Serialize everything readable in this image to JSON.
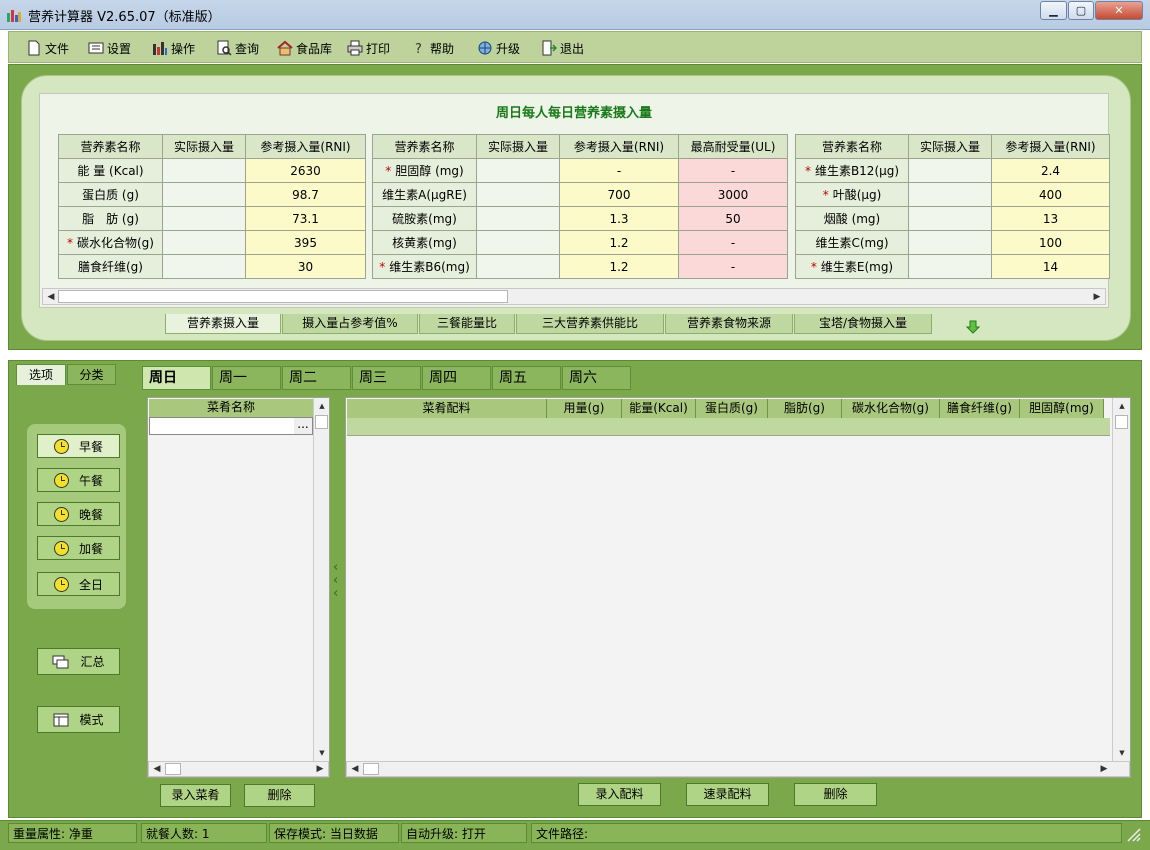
{
  "window": {
    "title": "营养计算器 V2.65.07（标准版）",
    "min": "▁",
    "max": "▢",
    "close": "✕"
  },
  "menu": [
    {
      "label": "文件",
      "icon": "file-icon"
    },
    {
      "label": "设置",
      "icon": "settings-icon"
    },
    {
      "label": "操作",
      "icon": "bar-chart-icon"
    },
    {
      "label": "查询",
      "icon": "search-doc-icon"
    },
    {
      "label": "食品库",
      "icon": "house-icon"
    },
    {
      "label": "打印",
      "icon": "printer-icon"
    },
    {
      "label": "帮助",
      "icon": "help-icon"
    },
    {
      "label": "升级",
      "icon": "globe-icon"
    },
    {
      "label": "退出",
      "icon": "exit-icon"
    }
  ],
  "nutrient_panel": {
    "title": "周日每人每日营养素摄入量",
    "table1": {
      "headers": [
        "营养素名称",
        "实际摄入量",
        "参考摄入量(RNI)"
      ],
      "rows": [
        {
          "star": false,
          "name": "能 量 (Kcal)",
          "actual": "",
          "rni": "2630"
        },
        {
          "star": false,
          "name": "蛋白质 (g)",
          "actual": "",
          "rni": "98.7"
        },
        {
          "star": false,
          "name": "脂　肪 (g)",
          "actual": "",
          "rni": "73.1"
        },
        {
          "star": true,
          "name": "碳水化合物(g)",
          "actual": "",
          "rni": "395"
        },
        {
          "star": false,
          "name": "膳食纤维(g)",
          "actual": "",
          "rni": "30"
        }
      ]
    },
    "table2": {
      "headers": [
        "营养素名称",
        "实际摄入量",
        "参考摄入量(RNI)",
        "最高耐受量(UL)"
      ],
      "rows": [
        {
          "star": true,
          "name": "胆固醇 (mg)",
          "actual": "",
          "rni": "-",
          "ul": "-"
        },
        {
          "star": false,
          "name": "维生素A(μgRE)",
          "actual": "",
          "rni": "700",
          "ul": "3000"
        },
        {
          "star": false,
          "name": "硫胺素(mg)",
          "actual": "",
          "rni": "1.3",
          "ul": "50"
        },
        {
          "star": false,
          "name": "核黄素(mg)",
          "actual": "",
          "rni": "1.2",
          "ul": "-"
        },
        {
          "star": true,
          "name": "维生素B6(mg)",
          "actual": "",
          "rni": "1.2",
          "ul": "-"
        }
      ]
    },
    "table3": {
      "headers": [
        "营养素名称",
        "实际摄入量",
        "参考摄入量(RNI)"
      ],
      "rows": [
        {
          "star": true,
          "name": "维生素B12(μg)",
          "actual": "",
          "rni": "2.4"
        },
        {
          "star": true,
          "name": "叶酸(μg)",
          "actual": "",
          "rni": "400"
        },
        {
          "star": false,
          "name": "烟酸 (mg)",
          "actual": "",
          "rni": "13"
        },
        {
          "star": false,
          "name": "维生素C(mg)",
          "actual": "",
          "rni": "100"
        },
        {
          "star": true,
          "name": "维生素E(mg)",
          "actual": "",
          "rni": "14"
        }
      ]
    }
  },
  "bottom_tabs": [
    "营养素摄入量",
    "摄入量占参考值%",
    "三餐能量比",
    "三大营养素供能比",
    "营养素食物来源",
    "宝塔/食物摄入量"
  ],
  "left_tabs": [
    "选项",
    "分类"
  ],
  "meal_buttons": [
    "早餐",
    "午餐",
    "晚餐",
    "加餐",
    "全日"
  ],
  "extra_buttons": [
    "汇总",
    "模式"
  ],
  "day_tabs": [
    "周日",
    "周一",
    "周二",
    "周三",
    "周四",
    "周五",
    "周六"
  ],
  "dish_header": "菜肴名称",
  "dish_input": "",
  "grid_headers": [
    "菜肴配料",
    "用量(g)",
    "能量(Kcal)",
    "蛋白质(g)",
    "脂肪(g)",
    "碳水化合物(g)",
    "膳食纤维(g)",
    "胆固醇(mg)"
  ],
  "buttons": {
    "add_dish": "录入菜肴",
    "delete_dish": "删除",
    "add_ingredient": "录入配料",
    "quick_ingredient": "速录配料",
    "delete_ingredient": "删除"
  },
  "status": {
    "weight": "重量属性: 净重",
    "diners": "就餐人数: 1",
    "save_mode": "保存模式: 当日数据",
    "auto_update": "自动升级: 打开",
    "file_path": "文件路径:"
  },
  "ellipsis": "..."
}
